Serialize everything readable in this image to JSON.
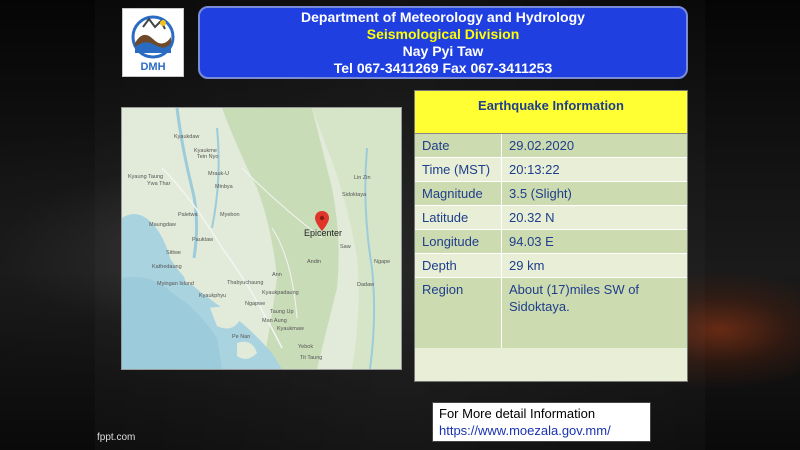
{
  "header": {
    "line1": "Department of Meteorology and Hydrology",
    "line2": "Seismological  Division",
    "line3": "Nay Pyi Taw",
    "line4": "Tel 067-3411269  Fax 067-3411253"
  },
  "logo": {
    "text": "DMH"
  },
  "map": {
    "epicenter_label": "Epicenter",
    "place_labels": {
      "kyaukdaw": "Kyaukdaw",
      "kyaukme": "Kyaukme",
      "tein_nyo": "Tein Nyo",
      "mrauk_u": "Mrauk-U",
      "kyaung_taung": "Kyaung Taung",
      "ywa_thar": "Ywa Thar",
      "minbya": "Minbya",
      "paletwa": "Paletwa",
      "maungdaw": "Maungdaw",
      "sittwe": "Sittwe",
      "pauktaw": "Pauktaw",
      "myebon": "Myebon",
      "kathedaung": "Kathedaung",
      "myingan_island": "Myingan Island",
      "kyaukphyu": "Kyaukphyu",
      "ann": "Ann",
      "thabyuchaung": "Thabyuchaung",
      "ngapwe": "Ngapwe",
      "sidoktaya": "Sidoktaya",
      "lin_zin": "Lin Zin",
      "ngape": "Ngape",
      "saw": "Saw",
      "dadaw": "Dadaw",
      "kyaukpadaung": "Kyaukpadaung",
      "taung_up": "Taung Up",
      "thandwe_bay": "Tit Taung",
      "yebok": "Yebok",
      "pe_nan": "Pe Nan",
      "andin": "Andin",
      "kyaukmaw": "Kyaukmaw",
      "man_aung": "Man Aung"
    }
  },
  "info": {
    "title": "Earthquake Information",
    "rows": [
      {
        "label": "Date",
        "value": "29.02.2020"
      },
      {
        "label": "Time (MST)",
        "value": "20:13:22"
      },
      {
        "label": "Magnitude",
        "value": "3.5 (Slight)"
      },
      {
        "label": "Latitude",
        "value": "20.32 N"
      },
      {
        "label": "Longitude",
        "value": "94.03 E"
      },
      {
        "label": "Depth",
        "value": "29 km"
      },
      {
        "label": "Region",
        "value": "About (17)miles SW of Sidoktaya."
      }
    ]
  },
  "footer": {
    "more_text": "For More detail Information",
    "url": "https://www.moezala.gov.mm/",
    "watermark": "fppt.com"
  },
  "colors": {
    "header_bg": "#1f3fe0",
    "header_accent": "#ffff00",
    "table_title_bg": "#ffff33",
    "table_text": "#1f3e8c",
    "row_dark": "#cddbb0",
    "row_light": "#e8efd6",
    "link": "#1a32b0"
  }
}
